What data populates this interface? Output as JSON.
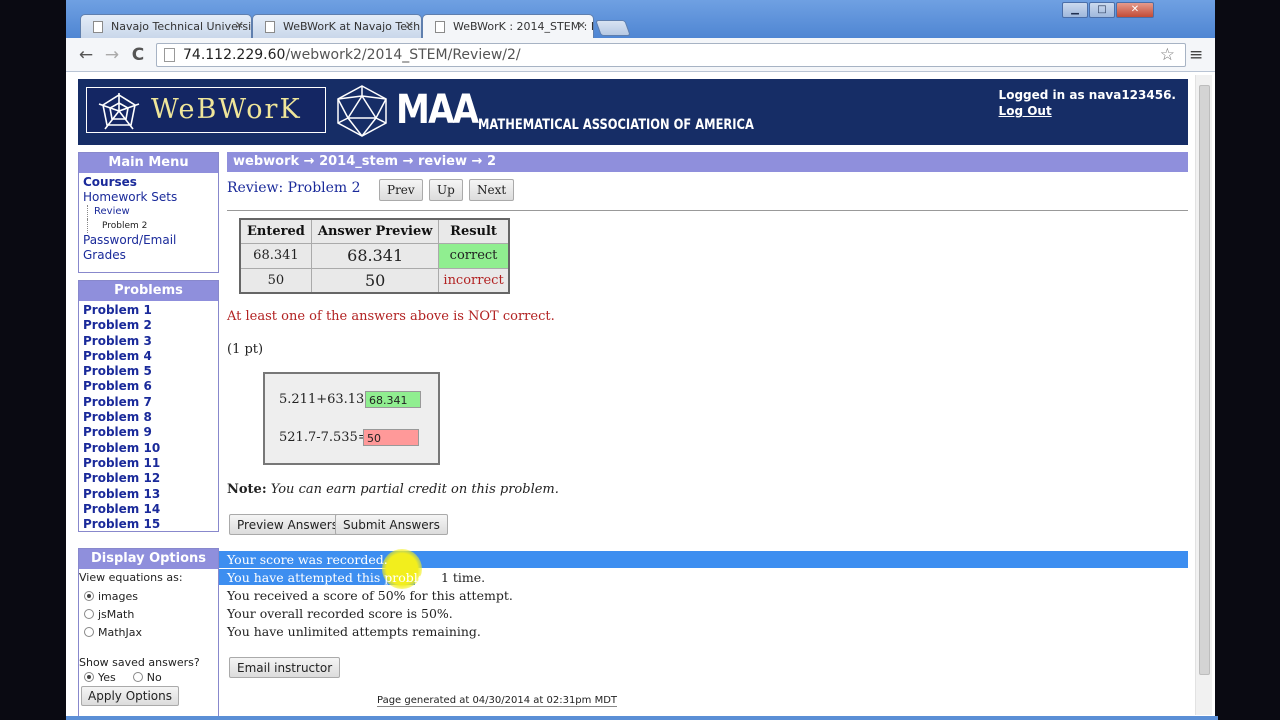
{
  "browser": {
    "tabs": [
      {
        "title": "Navajo Technical Universi"
      },
      {
        "title": "WeBWorK at Navajo Tech"
      },
      {
        "title": "WeBWorK : 2014_STEM : R"
      }
    ],
    "url_host": "74.112.229.60",
    "url_path": "/webwork2/2014_STEM/Review/2/",
    "window_buttons": {
      "minimize": "▁",
      "maximize": "□",
      "close": "✕"
    },
    "nav": {
      "back": "←",
      "forward": "→",
      "reload": "C"
    }
  },
  "banner": {
    "webwork_logo": "WeBWorK",
    "maa_short": "MAA",
    "maa_full": "MATHEMATICAL ASSOCIATION OF AMERICA",
    "logged_in": "Logged in as nava123456.",
    "logout": "Log Out"
  },
  "main_menu": {
    "title": "Main Menu",
    "courses": "Courses",
    "homework_sets": "Homework Sets",
    "review": "Review",
    "problem2": "Problem 2",
    "password": "Password/Email",
    "grades": "Grades"
  },
  "problems": {
    "title": "Problems",
    "items": [
      "Problem 1",
      "Problem 2",
      "Problem 3",
      "Problem 4",
      "Problem 5",
      "Problem 6",
      "Problem 7",
      "Problem 8",
      "Problem 9",
      "Problem 10",
      "Problem 11",
      "Problem 12",
      "Problem 13",
      "Problem 14",
      "Problem 15"
    ]
  },
  "display_options": {
    "title": "Display Options",
    "view_as": "View equations as:",
    "opt_images": "images",
    "opt_jsmath": "jsMath",
    "opt_mathjax": "MathJax",
    "show_saved": "Show saved answers?",
    "yes": "Yes",
    "no": "No",
    "apply": "Apply Options"
  },
  "content": {
    "breadcrumb": "webwork → 2014_stem → review → 2",
    "title": "Review: Problem 2",
    "prev": "Prev",
    "up": "Up",
    "next": "Next",
    "table": {
      "headers": [
        "Entered",
        "Answer Preview",
        "Result"
      ],
      "rows": [
        {
          "entered": "68.341",
          "preview": "68.341",
          "result": "correct"
        },
        {
          "entered": "50",
          "preview": "50",
          "result": "incorrect"
        }
      ]
    },
    "not_correct": "At least one of the answers above is NOT correct.",
    "points": "(1 pt)",
    "eq1": "5.211+63.13=",
    "ans1": "68.341",
    "eq2": "521.7-7.535=",
    "ans2": "50",
    "note_label": "Note:",
    "note_text": "You can earn partial credit on this problem.",
    "preview_btn": "Preview Answers",
    "submit_btn": "Submit Answers",
    "score_recorded": "Your score was recorded.",
    "attempted_pre": "You have attempted this problem ",
    "attempted_num": "1",
    "attempted_post": " time.",
    "received": "You received a score of 50% for this attempt.",
    "overall": "Your overall recorded score is 50%.",
    "unlimited": "You have unlimited attempts remaining.",
    "email_btn": "Email instructor",
    "footer": "Page generated at 04/30/2014 at 02:31pm MDT"
  },
  "colors": {
    "banner": "#162d66",
    "menu_header": "#8f8fdc",
    "correct": "#90ee90",
    "incorrect_field": "#ff9999",
    "highlight": "#3d8ef0"
  }
}
